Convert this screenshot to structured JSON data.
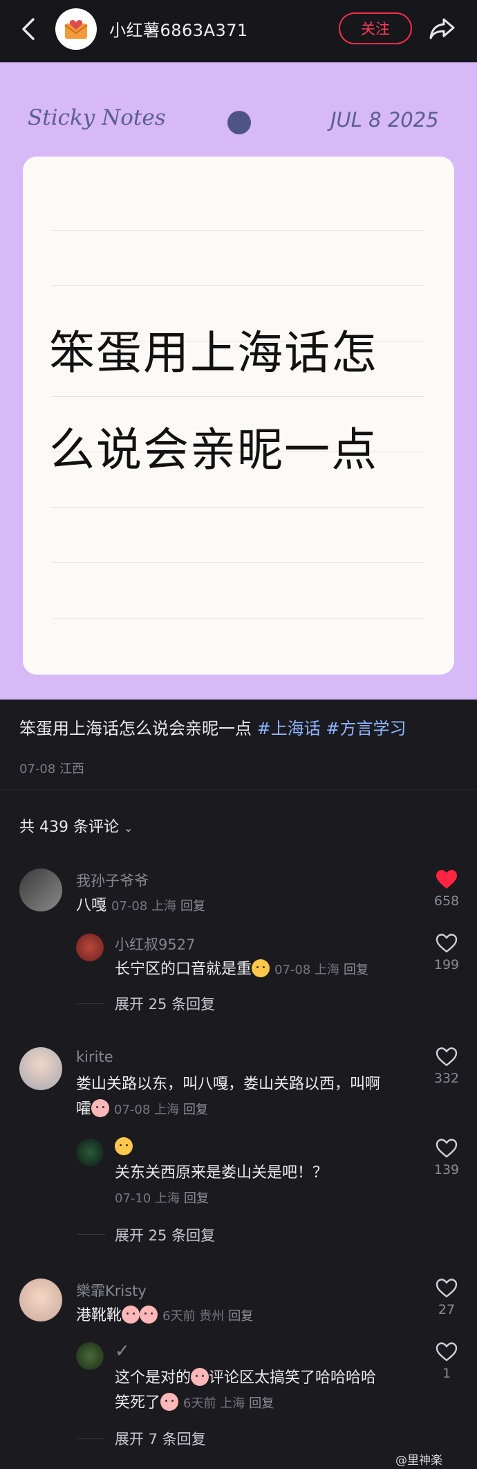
{
  "header": {
    "author_name": "小红薯6863A371",
    "follow_label": "关注"
  },
  "note_image": {
    "header_title": "Sticky Notes",
    "date": "JUL 8 2025",
    "line1": "笨蛋用上海话怎",
    "line2": "么说会亲昵一点"
  },
  "post": {
    "title": "笨蛋用上海话怎么说会亲昵一点",
    "tags": [
      "#上海话",
      "#方言学习"
    ],
    "meta": "07-08 江西"
  },
  "comments_header": {
    "label": "共 439 条评论"
  },
  "comments": [
    {
      "name": "我孙子爷爷",
      "text": "八嘎",
      "meta": "07-08 上海",
      "reply_label": "回复",
      "likes": "658",
      "liked": true,
      "reply": {
        "name": "小红叔9527",
        "text": "长宁区的口音就是重",
        "meta": "07-08 上海",
        "reply_label": "回复",
        "likes": "199"
      },
      "expand_label": "展开 25 条回复"
    },
    {
      "name": "kirite",
      "text1": "娄山关路以东，叫八嘎，娄山关路以西，叫啊",
      "text2": "嚯",
      "meta": "07-08 上海",
      "reply_label": "回复",
      "likes": "332",
      "reply": {
        "name": "😮",
        "text": "关东关西原来是娄山关是吧！？",
        "meta": "07-10 上海",
        "reply_label": "回复",
        "likes": "139"
      },
      "expand_label": "展开 25 条回复"
    },
    {
      "name": "樂霏Kristy",
      "text": "港靴靴",
      "meta": "6天前 贵州",
      "reply_label": "回复",
      "likes": "27",
      "reply": {
        "name": "✓",
        "text1": "这个是对的",
        "text1b": "评论区太搞笑了哈哈哈哈",
        "text2": "笑死了",
        "meta": "6天前 上海",
        "reply_label": "回复",
        "likes": "1"
      },
      "expand_label": "展开 7 条回复"
    }
  ],
  "watermark": "@里神楽",
  "colors": {
    "accent": "#ff2c4e",
    "note_bg": "#d6b9f6",
    "tag": "#8fb6ff",
    "liked_heart": "#ff2442"
  }
}
